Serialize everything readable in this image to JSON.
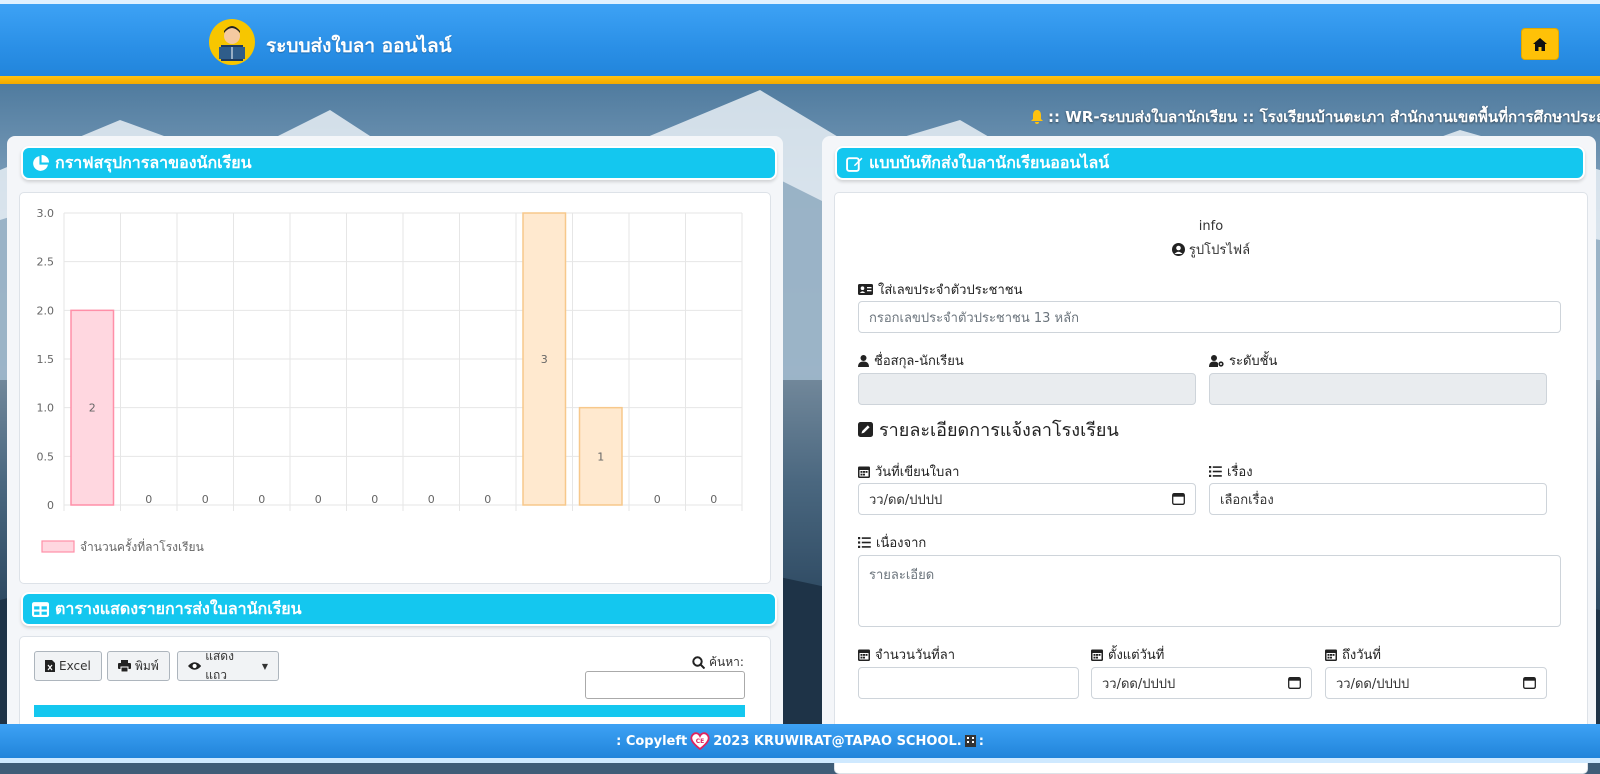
{
  "header": {
    "brand": "ระบบส่งใบลา ออนไลน์",
    "logo_icon": "student-reading-icon",
    "home_icon": "home-icon"
  },
  "marquee": {
    "text": ":: WR-ระบบส่งใบลานักเรียน :: โรงเรียนบ้านตะเภา สำนักงานเขตพื้นที่การศึกษาประถมศึกษา"
  },
  "chart_card": {
    "title": "กราฟสรุปการลาของนักเรียน",
    "icon": "pie-chart-icon"
  },
  "chart_data": {
    "type": "bar",
    "categories": [
      "",
      "",
      "",
      "",
      "",
      "",
      "",
      "",
      "",
      "",
      "",
      ""
    ],
    "values": [
      2,
      0,
      0,
      0,
      0,
      0,
      0,
      0,
      3,
      1,
      0,
      0
    ],
    "series": [
      {
        "name": "จำนวนครั้งที่ลาโรงเรียน",
        "values": [
          2,
          0,
          0,
          0,
          0,
          0,
          0,
          0,
          3,
          1,
          0,
          0
        ]
      }
    ],
    "bar_colors": [
      "#ffd7e0",
      "#ffe9cf",
      "#ffe9cf",
      "#ffe9cf",
      "#ffe9cf",
      "#ffe9cf",
      "#ffe9cf",
      "#ffe9cf",
      "#ffe9cf",
      "#ffe9cf",
      "#ffe9cf",
      "#ffe9cf"
    ],
    "bar_borders": [
      "#ff8fa8",
      "#f7c88b",
      "#f7c88b",
      "#f7c88b",
      "#f7c88b",
      "#f7c88b",
      "#f7c88b",
      "#f7c88b",
      "#f7c88b",
      "#f7c88b",
      "#f7c88b",
      "#f7c88b"
    ],
    "y_ticks": [
      "0",
      "0.5",
      "1.0",
      "1.5",
      "2.0",
      "2.5",
      "3.0"
    ],
    "ylim": [
      0,
      3
    ],
    "grid": true,
    "legend_position": "bottom-left",
    "title": "",
    "xlabel": "",
    "ylabel": ""
  },
  "table_card": {
    "title": "ตารางแสดงรายการส่งใบลานักเรียน",
    "icon": "table-icon",
    "btn_excel": "Excel",
    "btn_print": "พิมพ์",
    "btn_show": "แสดงแถว",
    "search_label": "ค้นหา:"
  },
  "form_card": {
    "title": "แบบบันทึกส่งใบลานักเรียนออนไลน์",
    "icon": "edit-icon",
    "profile_info": "info",
    "profile_label": "รูปโปรไฟล์",
    "id_label": "ใส่เลขประจำตัวประชาชน",
    "id_placeholder": "กรอกเลขประจำตัวประชาชน 13 หลัก",
    "name_label": "ชื่อสกุล-นักเรียน",
    "level_label": "ระดับชั้น",
    "section_title": "รายละเอียดการแจ้งลาโรงเรียน",
    "date_label": "วันที่เขียนใบลา",
    "date_value": "วว/ดด/ปปปป",
    "subject_label": "เรื่อง",
    "subject_value": "เลือกเรื่อง",
    "reason_label": "เนื่องจาก",
    "reason_placeholder": "รายละเอียด",
    "days_label": "จำนวนวันที่ลา",
    "from_label": "ตั้งแต่วันที่",
    "from_value": "วว/ดด/ปปปป",
    "to_label": "ถึงวันที่",
    "to_value": "วว/ดด/ปปปป"
  },
  "footer": {
    "left": ": Copyleft",
    "right": "2023 KRUWIRAT@TAPAO SCHOOL.",
    "end": ":"
  },
  "colors": {
    "accent": "#14c7ef",
    "header": "#2a8fe6",
    "stripe": "#ffc20e"
  }
}
